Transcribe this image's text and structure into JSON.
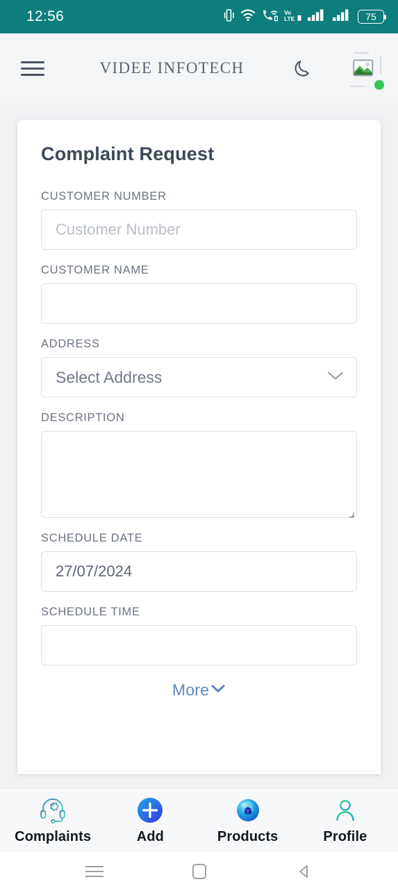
{
  "status_bar": {
    "time": "12:56",
    "battery_level": "75",
    "icons": [
      "vibrate-icon",
      "wifi-icon",
      "wifi-calling-icon",
      "volte-icon",
      "signal-bars-sim1-icon",
      "signal-bars-sim2-icon",
      "battery-icon"
    ],
    "background_color": "#0e7d7d"
  },
  "header": {
    "menu_icon": "hamburger-menu-icon",
    "title": "VIDEE INFOTECH",
    "theme_toggle_icon": "moon-icon",
    "avatar_icon": "broken-image-icon",
    "status_dot_color": "#35c759"
  },
  "form": {
    "title": "Complaint Request",
    "fields": [
      {
        "label": "CUSTOMER NUMBER",
        "type": "text",
        "value": "",
        "placeholder": "Customer Number"
      },
      {
        "label": "CUSTOMER NAME",
        "type": "text",
        "value": "",
        "placeholder": ""
      },
      {
        "label": "ADDRESS",
        "type": "select",
        "value": "Select Address",
        "placeholder": ""
      },
      {
        "label": "DESCRIPTION",
        "type": "textarea",
        "value": "",
        "placeholder": ""
      },
      {
        "label": "SCHEDULE DATE",
        "type": "text",
        "value": "27/07/2024",
        "placeholder": ""
      },
      {
        "label": "SCHEDULE TIME",
        "type": "text",
        "value": "",
        "placeholder": ""
      }
    ],
    "more_label": "More",
    "more_icon": "chevron-down-icon",
    "more_color": "#5f86c2"
  },
  "tabbar": {
    "items": [
      {
        "label": "Complaints",
        "icon": "support-headset-icon"
      },
      {
        "label": "Add",
        "icon": "plus-circle-icon"
      },
      {
        "label": "Products",
        "icon": "product-sphere-cube-icon"
      },
      {
        "label": "Profile",
        "icon": "person-outline-icon"
      }
    ]
  },
  "system_nav": {
    "recents_icon": "recents-lines-icon",
    "home_icon": "home-square-icon",
    "back_icon": "back-triangle-icon"
  }
}
